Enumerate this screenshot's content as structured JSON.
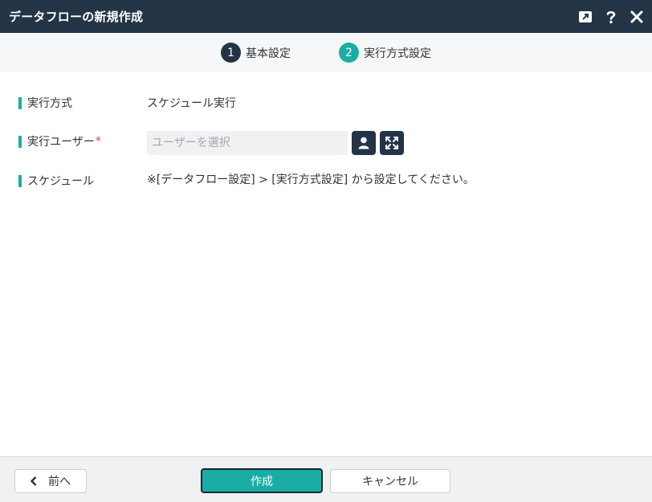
{
  "dialog": {
    "title": "データフローの新規作成"
  },
  "steps": [
    {
      "number": "1",
      "label": "基本設定"
    },
    {
      "number": "2",
      "label": "実行方式設定"
    }
  ],
  "form": {
    "execution_mode": {
      "label": "実行方式",
      "value": "スケジュール実行"
    },
    "execution_user": {
      "label": "実行ユーザー",
      "required_mark": "*",
      "placeholder": "ユーザーを選択",
      "value": ""
    },
    "schedule": {
      "label": "スケジュール",
      "value": "※[データフロー設定] > [実行方式設定] から設定してください。"
    }
  },
  "footer": {
    "prev_label": "前へ",
    "create_label": "作成",
    "cancel_label": "キャンセル"
  },
  "colors": {
    "header_bg": "#243447",
    "accent": "#1aada5",
    "required": "#e0474c"
  },
  "icons": {
    "title_bar": [
      "expand-icon",
      "help-icon",
      "close-icon"
    ],
    "user_buttons": [
      "user-icon",
      "fullscreen-icon"
    ],
    "prev": "chevron-left-icon"
  }
}
